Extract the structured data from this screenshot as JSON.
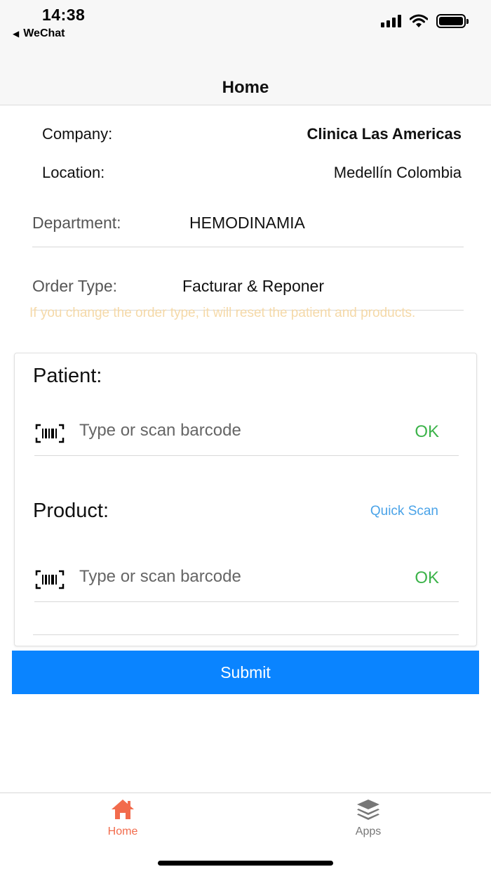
{
  "status_bar": {
    "time": "14:38",
    "back_app": "WeChat",
    "back_icon": "back-triangle-icon",
    "icons": [
      "signal-icon",
      "wifi-icon",
      "battery-icon"
    ]
  },
  "nav": {
    "title": "Home"
  },
  "info": {
    "company_label": "Company:",
    "company_value": "Clinica Las Americas",
    "location_label": "Location:",
    "location_value": "Medellín Colombia"
  },
  "form": {
    "department_label": "Department:",
    "department_value": "HEMODINAMIA",
    "order_type_label": "Order Type:",
    "order_type_value": "Facturar & Reponer",
    "warning": "If you change the order type, it will reset the patient and products."
  },
  "patient": {
    "title": "Patient:",
    "placeholder": "Type or scan barcode",
    "ok_label": "OK"
  },
  "product": {
    "title": "Product:",
    "quick_scan_label": "Quick Scan",
    "placeholder": "Type or scan barcode",
    "ok_label": "OK"
  },
  "submit_label": "Submit",
  "tabs": [
    {
      "label": "Home",
      "icon": "home-icon",
      "active": true
    },
    {
      "label": "Apps",
      "icon": "layers-icon",
      "active": false
    }
  ],
  "colors": {
    "accent": "#0a84ff",
    "ok": "#3cb34a",
    "quick_scan": "#4aa3e8",
    "warning": "#f5d9a8",
    "tab_active": "#f26b4c",
    "tab_inactive": "#777777"
  }
}
